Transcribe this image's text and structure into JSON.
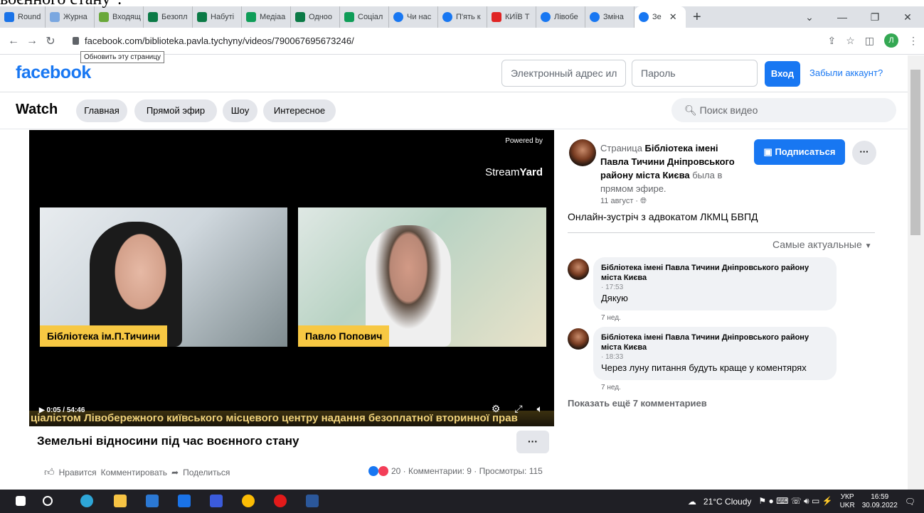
{
  "doc_overlay_text": "воєнного стану\".",
  "browser": {
    "tabs": [
      {
        "label": "Round",
        "color": "#1a73e8"
      },
      {
        "label": "Журна",
        "color": "#7aa7e0"
      },
      {
        "label": "Входящ",
        "color": "#69a83a"
      },
      {
        "label": "Безопл",
        "color": "#0b7a46"
      },
      {
        "label": "Набуті",
        "color": "#0b7a46"
      },
      {
        "label": "Медіаа",
        "color": "#0f9d58"
      },
      {
        "label": "Одноо",
        "color": "#0b7a46"
      },
      {
        "label": "Соціал",
        "color": "#0f9d58"
      },
      {
        "label": "Чи нас",
        "color": "#1877f2"
      },
      {
        "label": "П'ять к",
        "color": "#1877f2"
      },
      {
        "label": "КИЇВ Т",
        "color": "#e02424"
      },
      {
        "label": "Лівобе",
        "color": "#1877f2"
      },
      {
        "label": "Зміна",
        "color": "#1877f2"
      },
      {
        "label": "Зе",
        "color": "#1877f2"
      }
    ],
    "url": "facebook.com/biblioteka.pavla.tychyny/videos/790067695673246/",
    "tooltip": "Обновить эту страницу",
    "profile_initial": "Л"
  },
  "fb": {
    "logo": "facebook",
    "email_placeholder": "Электронный адрес ил",
    "password_placeholder": "Пароль",
    "login": "Вход",
    "forgot": "Забыли аккаунт?"
  },
  "watch": {
    "title": "Watch",
    "tabs": [
      "Главная",
      "Прямой эфир",
      "Шоу",
      "Интересное"
    ],
    "search_placeholder": "Поиск видео"
  },
  "video": {
    "powered_by": "Powered by",
    "brand_light": "Stream",
    "brand_bold": "Yard",
    "cam1_name": "Бібліотека ім.П.Тичини",
    "cam2_name": "Павло Попович",
    "ticker": "ціалістом Лівобережного київського місцевого центру надання безоплатної вторинної прав",
    "time": "0:05 / 54:46",
    "title": "Земельні відносини під час воєнного стану",
    "more": "···"
  },
  "actions": {
    "like": "Нравится",
    "comment": "Комментировать",
    "share": "Поделиться",
    "stats": "20 · Комментарии: 9 · Просмотры: 115"
  },
  "page": {
    "prefix": "Страница ",
    "name": "Бібліотека імені Павла Тичини Дніпровського району міста Києва",
    "suffix": " была в прямом эфире.",
    "datetime": "11 август ·",
    "subscribe": "Подписаться",
    "more": "···",
    "description": "Онлайн-зустріч з адвокатом ЛКМЦ БВПД",
    "sort": "Самые актуальные"
  },
  "comments": [
    {
      "author": "Бібліотека імені Павла Тичини Дніпровського району міста Києва",
      "time": "· 17:53",
      "text": "Дякую",
      "age": "7 нед."
    },
    {
      "author": "Бібліотека імені Павла Тичини Дніпровського району міста Києва",
      "time": "· 18:33",
      "text": "Через луну питання будуть краще у коментярях",
      "age": "7 нед."
    }
  ],
  "show_more": "Показать ещё 7 комментариев",
  "taskbar": {
    "weather": "21°C  Cloudy",
    "lang_top": "УКР",
    "lang_bottom": "UKR",
    "time": "16:59",
    "date": "30.09.2022"
  }
}
